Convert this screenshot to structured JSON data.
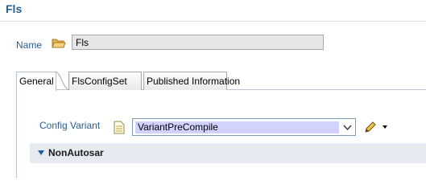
{
  "editor": {
    "title": "Fls"
  },
  "general": {
    "name_label": "Name",
    "name_value": "Fls"
  },
  "tabs": [
    {
      "label": "General",
      "active": true
    },
    {
      "label": "FlsConfigSet",
      "active": false
    },
    {
      "label": "Published Information",
      "active": false
    }
  ],
  "config": {
    "label": "Config Variant",
    "selected_value": "VariantPreCompile"
  },
  "section": {
    "title": "NonAutosar",
    "expanded": true
  },
  "colors": {
    "label_blue": "#2a5d91",
    "selection": "#d2d2ff",
    "section_bg": "#e6ebf1"
  },
  "icons": [
    "folder-icon",
    "document-icon",
    "chevron-down-icon",
    "pencil-icon",
    "dropdown-arrow-icon",
    "expand-triangle-icon"
  ]
}
